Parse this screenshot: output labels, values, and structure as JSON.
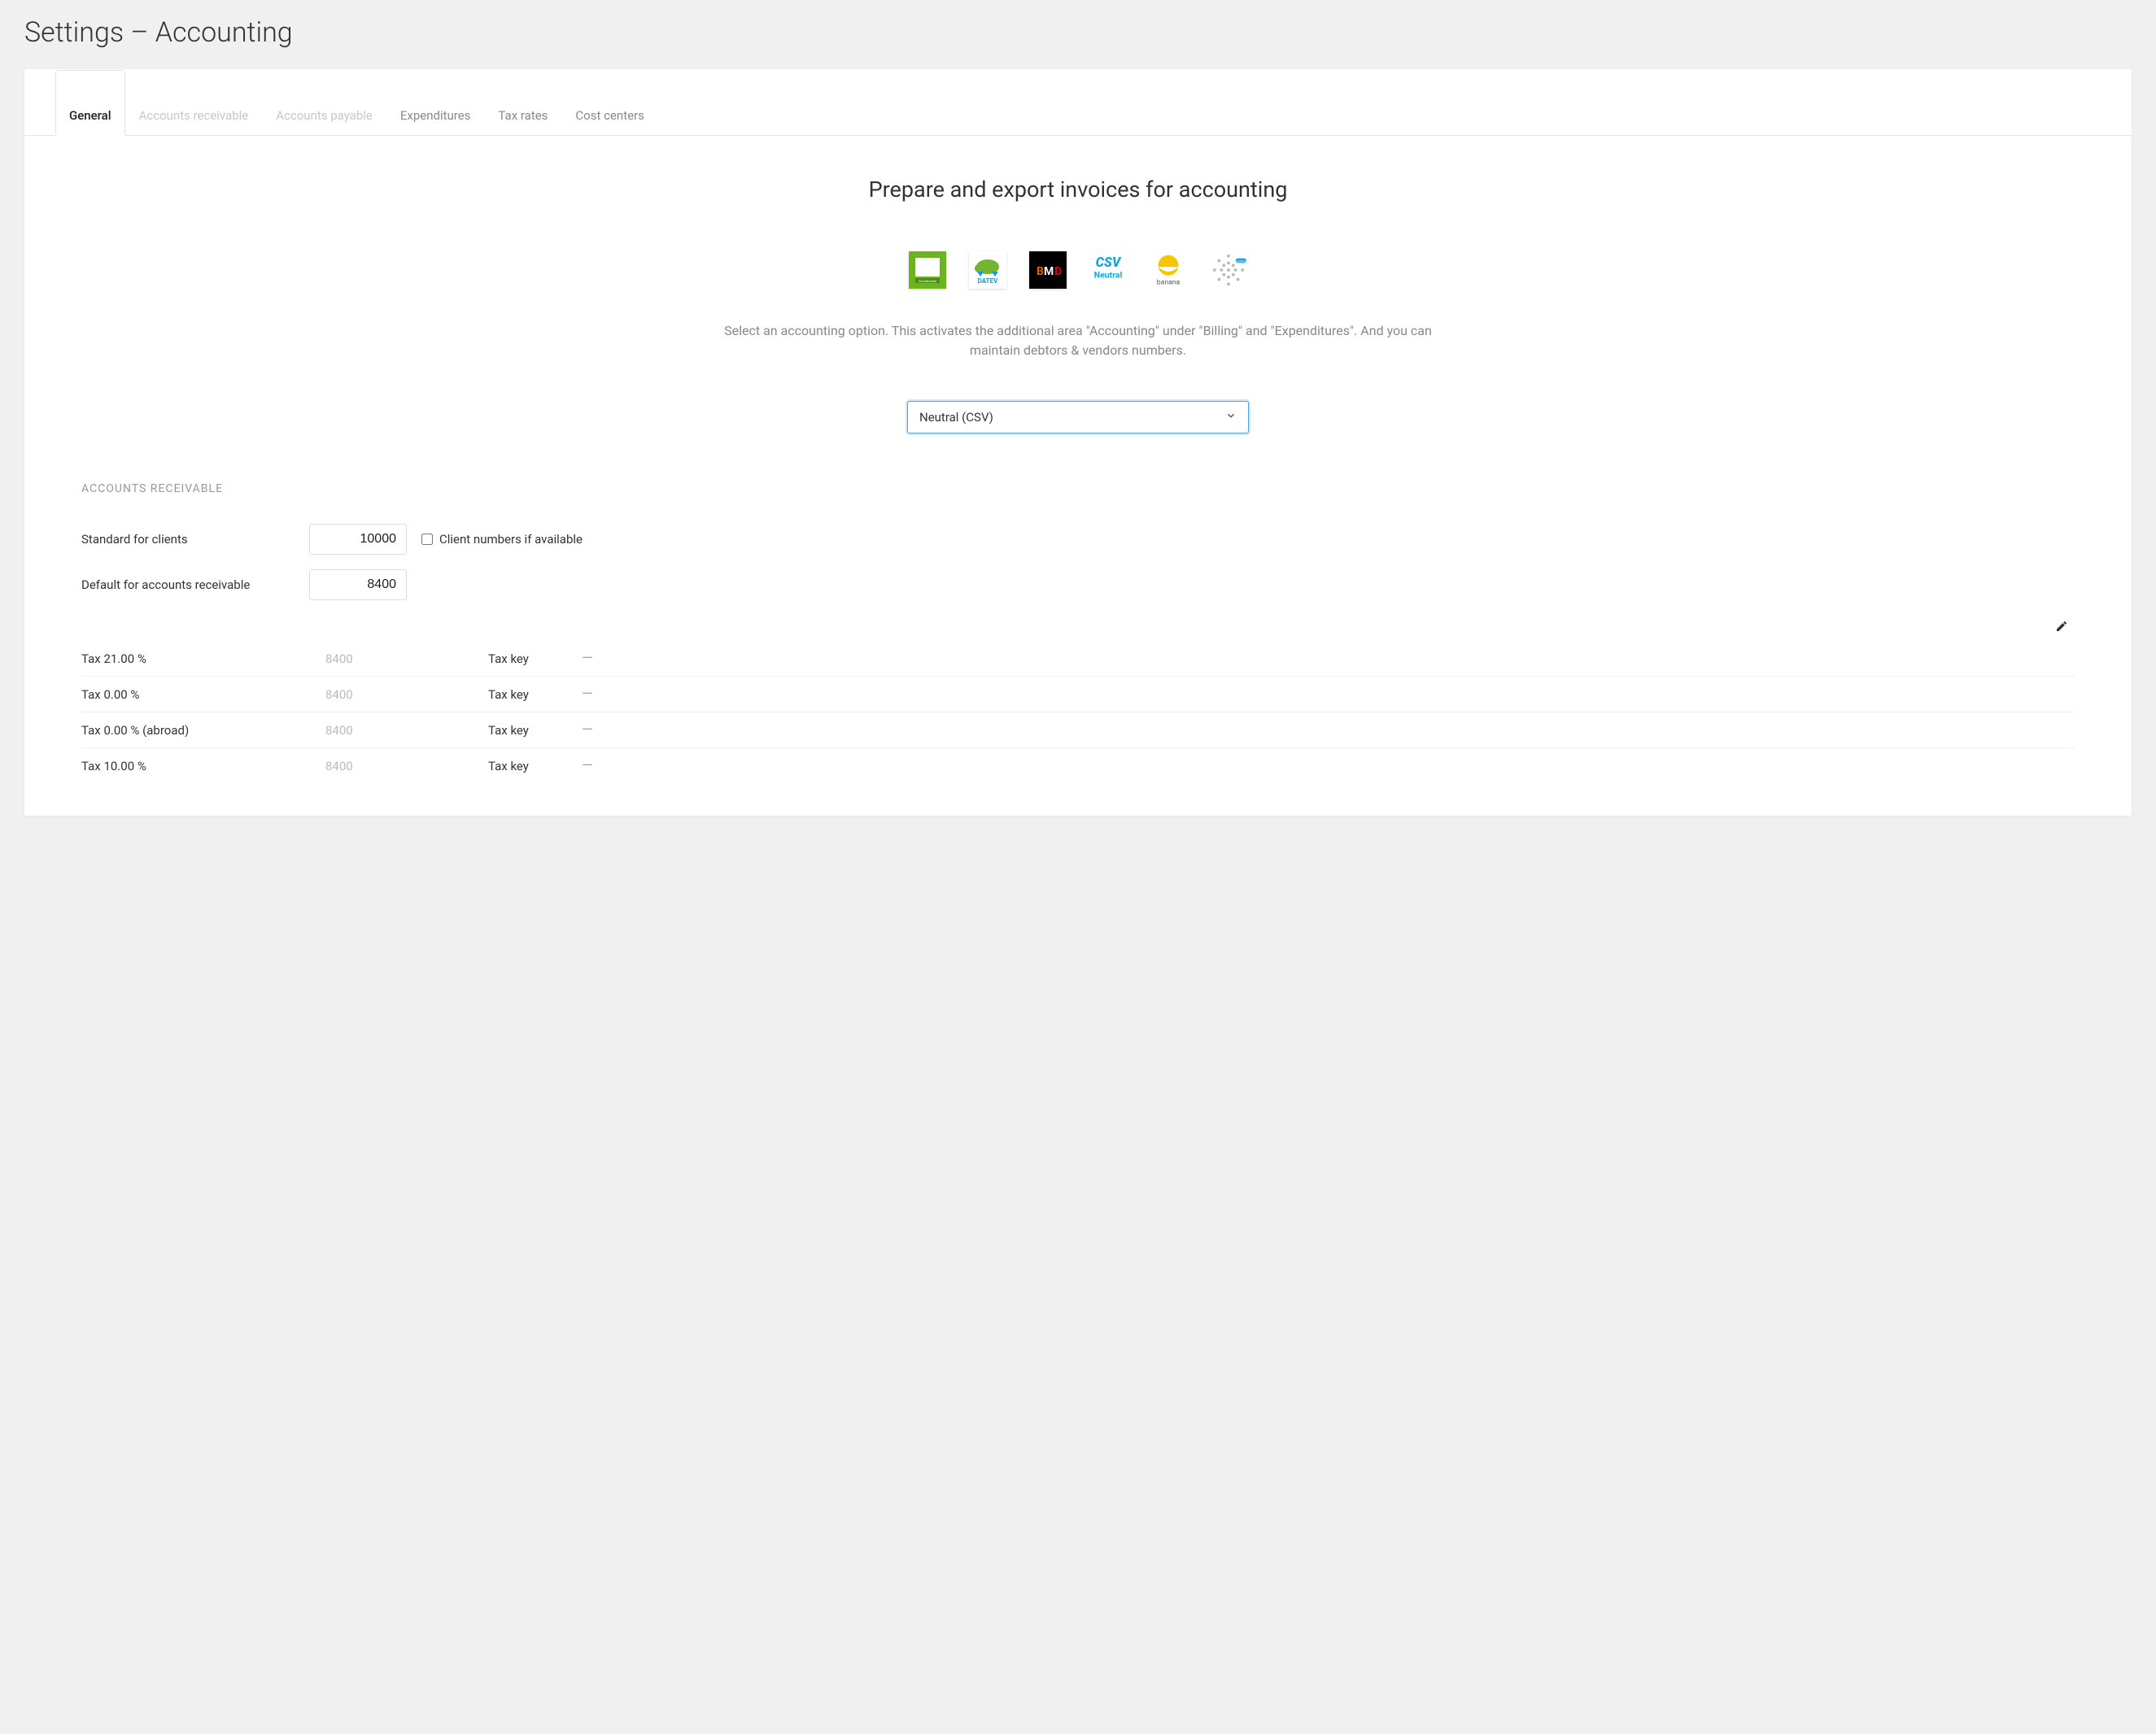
{
  "page_title": "Settings – Accounting",
  "tabs": [
    {
      "label": "General",
      "active": true,
      "disabled": false
    },
    {
      "label": "Accounts receivable",
      "active": false,
      "disabled": true
    },
    {
      "label": "Accounts payable",
      "active": false,
      "disabled": true
    },
    {
      "label": "Expenditures",
      "active": false,
      "disabled": false
    },
    {
      "label": "Tax rates",
      "active": false,
      "disabled": false
    },
    {
      "label": "Cost centers",
      "active": false,
      "disabled": false
    }
  ],
  "section_heading": "Prepare and export invoices for accounting",
  "logos": [
    "DATEV Schnittstelle",
    "DATEV",
    "BMD",
    "CSV Neutral",
    "banana",
    "scoring"
  ],
  "help_text": "Select an accounting option. This activates the additional area \"Accounting\" under \"Billing\" and \"Expenditures\". And you can maintain debtors & vendors numbers.",
  "select": {
    "value": "Neutral (CSV)"
  },
  "ar_section_title": "ACCOUNTS RECEIVABLE",
  "fields": {
    "standard_clients_label": "Standard for clients",
    "standard_clients_value": "10000",
    "client_numbers_label": "Client numbers if available",
    "client_numbers_checked": false,
    "default_ar_label": "Default for accounts receivable",
    "default_ar_value": "8400"
  },
  "tax_rows": [
    {
      "name": "Tax 21.00 %",
      "value": "8400",
      "key_label": "Tax key",
      "key_value": "—"
    },
    {
      "name": "Tax 0.00 %",
      "value": "8400",
      "key_label": "Tax key",
      "key_value": "—"
    },
    {
      "name": "Tax 0.00 % (abroad)",
      "value": "8400",
      "key_label": "Tax key",
      "key_value": "—"
    },
    {
      "name": "Tax 10.00 %",
      "value": "8400",
      "key_label": "Tax key",
      "key_value": "—"
    }
  ]
}
